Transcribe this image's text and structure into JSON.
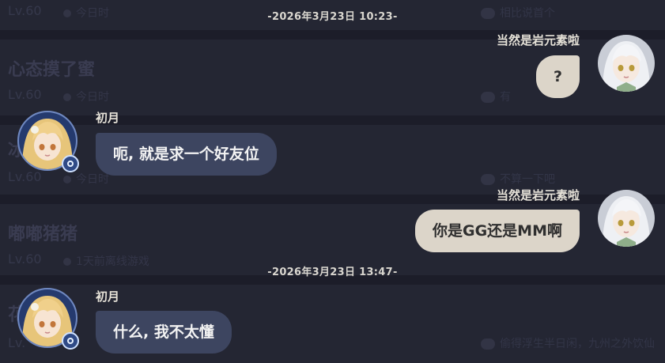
{
  "background": {
    "rows": [
      {
        "name": "",
        "level": "Lv.60",
        "status": "今日时",
        "signature": "相比说首个"
      },
      {
        "name": "心态摸了蜜",
        "level": "Lv.60",
        "status": "今日时",
        "signature": "有"
      },
      {
        "name": "冰冰冷",
        "level": "Lv.60",
        "status": "今日时",
        "signature": "不算一下吧"
      },
      {
        "name": "嘟嘟猪猪",
        "level": "Lv.60",
        "status": "1天前离线游戏",
        "signature": ""
      },
      {
        "name": "花花朵",
        "level": "Lv.",
        "status": "",
        "signature": "偷得浮生半日闲，九州之外饮仙"
      }
    ]
  },
  "chat": {
    "timestamps": [
      "-2026年3月23日 10:23-",
      "-2026年3月23日 13:47-"
    ],
    "messages": [
      {
        "sender": "当然是岩元素啦",
        "side": "right",
        "text": "?"
      },
      {
        "sender": "初月",
        "side": "left",
        "text": "呃, 就是求一个好友位"
      },
      {
        "sender": "当然是岩元素啦",
        "side": "right",
        "text": "你是GG还是MM啊"
      },
      {
        "sender": "初月",
        "side": "left",
        "text": "什么, 我不太懂"
      }
    ]
  },
  "colors": {
    "left_bubble": "#3d4560",
    "right_bubble": "#dcd5c9",
    "avatar_ring": "#6f88c0"
  }
}
